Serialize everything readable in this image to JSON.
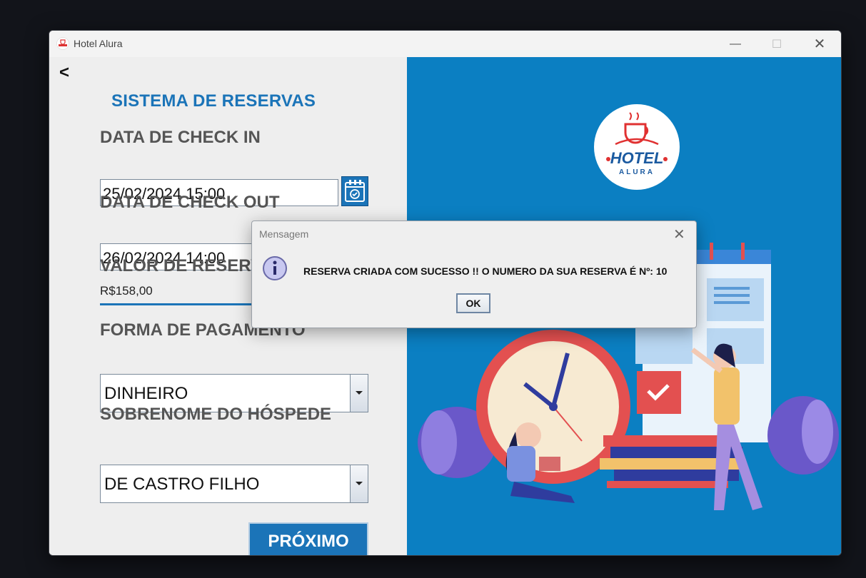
{
  "window": {
    "title": "Hotel Alura",
    "minimize_glyph": "—",
    "maximize_glyph": "☐",
    "close_glyph": "✕"
  },
  "nav": {
    "back_label": "<"
  },
  "form": {
    "title": "SISTEMA DE RESERVAS",
    "checkin_label": "DATA DE CHECK IN",
    "checkin_value": "25/02/2024 15:00",
    "checkout_label": "DATA DE CHECK OUT",
    "checkout_value": "26/02/2024 14:00",
    "valor_label": "VALOR DE RESERVA",
    "valor_value": "R$158,00",
    "pagamento_label": "FORMA DE PAGAMENTO",
    "pagamento_value": "DINHEIRO",
    "sobrenome_label": "SOBRENOME DO HÓSPEDE",
    "sobrenome_value": "DE CASTRO FILHO",
    "next_label": "PRÓXIMO"
  },
  "logo": {
    "main_text": "HOTEL",
    "sub_text": "ALURA"
  },
  "dialog": {
    "title": "Mensagem",
    "close_glyph": "✕",
    "message": "RESERVA CRIADA COM SUCESSO !! O NUMERO DA SUA RESERVA É Nº: 10",
    "ok_label": "OK"
  },
  "colors": {
    "accent": "#1b74b8",
    "panel_blue": "#0b7fc2",
    "logo_red": "#e03131"
  }
}
